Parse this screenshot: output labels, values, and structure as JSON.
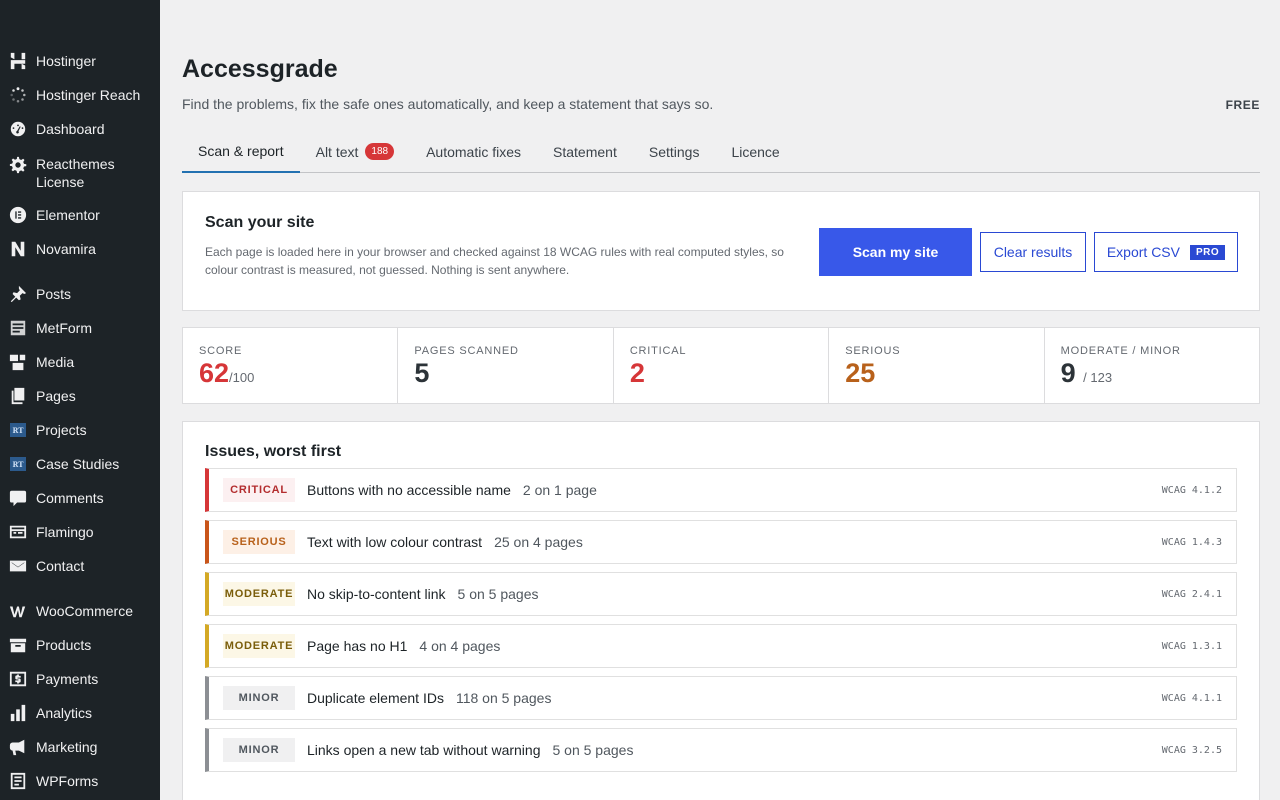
{
  "sidebar": {
    "items": [
      {
        "label": "Hostinger",
        "icon": "hostinger-logo-icon"
      },
      {
        "label": "Hostinger Reach",
        "icon": "spinner-icon"
      },
      {
        "label": "Dashboard",
        "icon": "dashboard-gauge-icon"
      },
      {
        "label": "Reacthemes License",
        "icon": "gear-icon"
      },
      {
        "label": "Elementor",
        "icon": "elementor-icon"
      },
      {
        "label": "Novamira",
        "icon": "novamira-n-icon"
      },
      {
        "label": "Posts",
        "icon": "pushpin-icon"
      },
      {
        "label": "MetForm",
        "icon": "metform-icon"
      },
      {
        "label": "Media",
        "icon": "media-icon"
      },
      {
        "label": "Pages",
        "icon": "pages-icon"
      },
      {
        "label": "Projects",
        "icon": "rt-badge-icon",
        "badge": "RT"
      },
      {
        "label": "Case Studies",
        "icon": "rt-badge-icon",
        "badge": "RT"
      },
      {
        "label": "Comments",
        "icon": "comment-bubble-icon"
      },
      {
        "label": "Flamingo",
        "icon": "flamingo-icon"
      },
      {
        "label": "Contact",
        "icon": "envelope-icon"
      },
      {
        "label": "WooCommerce",
        "icon": "woocommerce-icon"
      },
      {
        "label": "Products",
        "icon": "archive-box-icon"
      },
      {
        "label": "Payments",
        "icon": "dollar-card-icon"
      },
      {
        "label": "Analytics",
        "icon": "bar-chart-icon"
      },
      {
        "label": "Marketing",
        "icon": "megaphone-icon"
      },
      {
        "label": "WPForms",
        "icon": "wpforms-icon"
      }
    ]
  },
  "header": {
    "title": "Accessgrade",
    "subtitle": "Find the problems, fix the safe ones automatically, and keep a statement that says so.",
    "plan": "FREE"
  },
  "tabs": [
    {
      "label": "Scan & report",
      "active": true
    },
    {
      "label": "Alt text",
      "count": "188"
    },
    {
      "label": "Automatic fixes"
    },
    {
      "label": "Statement"
    },
    {
      "label": "Settings"
    },
    {
      "label": "Licence"
    }
  ],
  "scan": {
    "title": "Scan your site",
    "description": "Each page is loaded here in your browser and checked against 18 WCAG rules with real computed styles, so colour contrast is measured, not guessed. Nothing is sent anywhere.",
    "scan_button": "Scan my site",
    "clear_button": "Clear results",
    "export_button": "Export CSV",
    "export_tag": "PRO"
  },
  "stats": [
    {
      "label": "SCORE",
      "value": "62",
      "suffix": "/100",
      "color": "#d63638"
    },
    {
      "label": "PAGES SCANNED",
      "value": "5",
      "suffix": "",
      "color": "#2c3338"
    },
    {
      "label": "CRITICAL",
      "value": "2",
      "suffix": "",
      "color": "#d63638"
    },
    {
      "label": "SERIOUS",
      "value": "25",
      "suffix": "",
      "color": "#b8611b"
    },
    {
      "label": "MODERATE / MINOR",
      "value": "9",
      "suffix": "/ 123",
      "color": "#2c3338"
    }
  ],
  "issues": {
    "title": "Issues, worst first",
    "items": [
      {
        "severity": "CRITICAL",
        "level": "critical",
        "name": "Buttons with no accessible name",
        "count": "2 on 1 page",
        "wcag": "WCAG 4.1.2"
      },
      {
        "severity": "SERIOUS",
        "level": "serious",
        "name": "Text with low colour contrast",
        "count": "25 on 4 pages",
        "wcag": "WCAG 1.4.3"
      },
      {
        "severity": "MODERATE",
        "level": "moderate",
        "name": "No skip-to-content link",
        "count": "5 on 5 pages",
        "wcag": "WCAG 2.4.1"
      },
      {
        "severity": "MODERATE",
        "level": "moderate",
        "name": "Page has no H1",
        "count": "4 on 4 pages",
        "wcag": "WCAG 1.3.1"
      },
      {
        "severity": "MINOR",
        "level": "minor",
        "name": "Duplicate element IDs",
        "count": "118 on 5 pages",
        "wcag": "WCAG 4.1.1"
      },
      {
        "severity": "MINOR",
        "level": "minor",
        "name": "Links open a new tab without warning",
        "count": "5 on 5 pages",
        "wcag": "WCAG 3.2.5"
      }
    ]
  }
}
